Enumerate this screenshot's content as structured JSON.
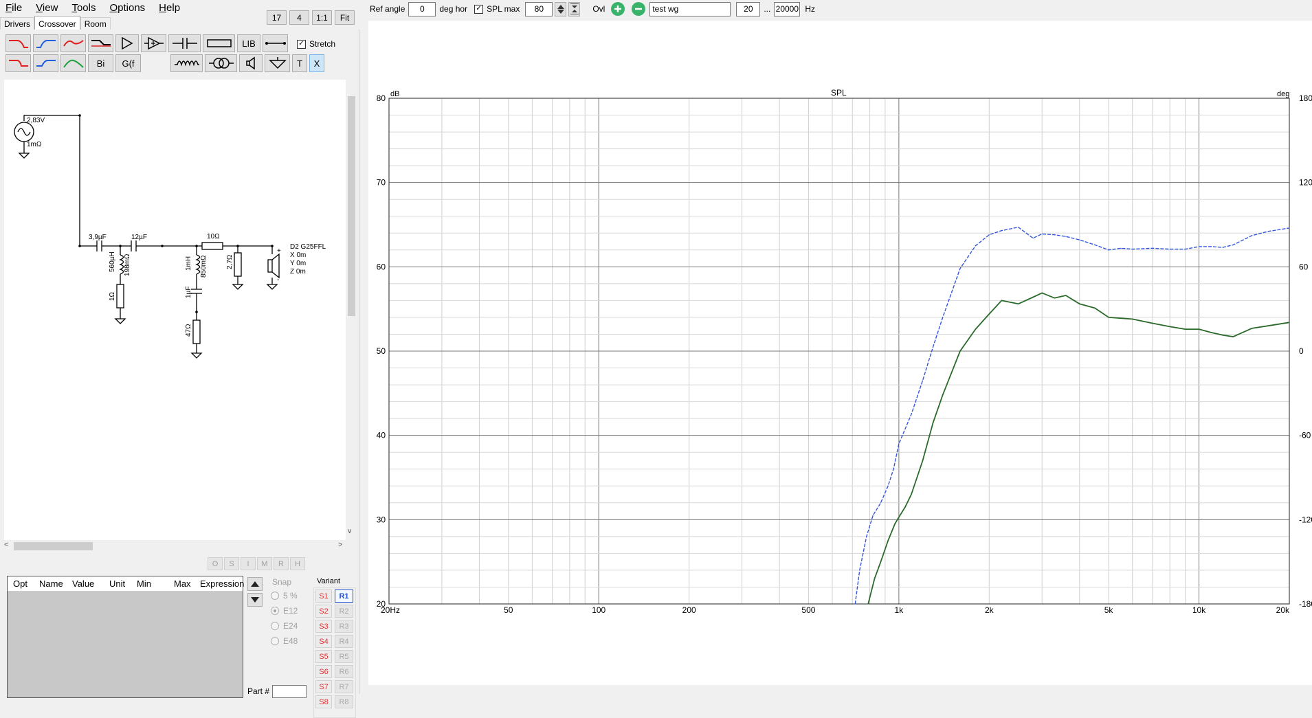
{
  "menu": [
    {
      "pre": "",
      "ul": "F",
      "post": "ile"
    },
    {
      "pre": "",
      "ul": "V",
      "post": "iew"
    },
    {
      "pre": "",
      "ul": "T",
      "post": "ools"
    },
    {
      "pre": "",
      "ul": "O",
      "post": "ptions"
    },
    {
      "pre": "",
      "ul": "H",
      "post": "elp"
    }
  ],
  "top_controls": {
    "grid1": "17",
    "grid2": "4",
    "zoom": "1:1",
    "fit": "Fit"
  },
  "tabs": [
    "Drivers",
    "Crossover",
    "Room"
  ],
  "active_tab": "Crossover",
  "toolbar": {
    "lib": "LIB",
    "bi": "Bi",
    "gf": "G(f",
    "t": "T",
    "x": "X",
    "stretch_label": "Stretch",
    "stretch_checked": true
  },
  "schematic": {
    "source_voltage": "2,83V",
    "source_res": "1mΩ",
    "c1": "3,9µF",
    "c2": "12µF",
    "l1": "560µH",
    "l1_res": "198mΩ",
    "r1": "1Ω",
    "l2": "1mH",
    "l2_res": "850mΩ",
    "c3": "1µF",
    "r2": "47Ω",
    "r_series": "10Ω",
    "r3": "2,7Ω",
    "driver": "D2 G25FFL",
    "driver_x": "X 0m",
    "driver_y": "Y 0m",
    "driver_z": "Z 0m",
    "plus": "+",
    "minus": "-"
  },
  "opt_buttons": [
    "O",
    "S",
    "I",
    "M",
    "R",
    "H"
  ],
  "opt_table": {
    "columns": [
      "Opt",
      "Name",
      "Value",
      "Unit",
      "Min",
      "Max",
      "Expression"
    ]
  },
  "snap": {
    "label": "Snap",
    "options": [
      "5 %",
      "E12",
      "E24",
      "E48"
    ],
    "selected": "E12"
  },
  "variant": {
    "label": "Variant",
    "s": [
      "S1",
      "S2",
      "S3",
      "S4",
      "S5",
      "S6",
      "S7",
      "S8"
    ],
    "r": [
      "R1",
      "R2",
      "R3",
      "R4",
      "R5",
      "R6",
      "R7",
      "R8"
    ],
    "selected": "R1"
  },
  "part": {
    "label": "Part #",
    "value": ""
  },
  "rightbar": {
    "ref_angle_label": "Ref angle",
    "ref_angle": "0",
    "deg_hor": "deg hor",
    "spl_max_label": "SPL max",
    "spl_max_checked": true,
    "spl_max": "80",
    "ovl": "Ovl",
    "name_field": "test wg",
    "f_low": "20",
    "dots": "...",
    "f_high": "20000",
    "hz": "Hz"
  },
  "colors": {
    "blue_series": "#3355dd",
    "green_series": "#2a6a2a",
    "add": "#3ab36a",
    "remove": "#3ab36a",
    "variant_s": "#e03030",
    "variant_sel": "#2050d0"
  },
  "chart_data": {
    "type": "line",
    "title": "SPL",
    "ylabel": "dB",
    "y2label": "deg",
    "xscale": "log",
    "xlim": [
      20,
      20000
    ],
    "ylim": [
      20,
      80
    ],
    "y2lim": [
      -180,
      180
    ],
    "x_ticks": [
      20,
      50,
      100,
      200,
      500,
      1000,
      2000,
      5000,
      10000,
      20000
    ],
    "x_tick_labels": [
      "20Hz",
      "50",
      "100",
      "200",
      "500",
      "1k",
      "2k",
      "5k",
      "10k",
      "20k"
    ],
    "y_ticks": [
      20,
      30,
      40,
      50,
      60,
      70,
      80
    ],
    "y_tick_labels": [
      "20",
      "30",
      "40",
      "50",
      "60",
      "70",
      "80"
    ],
    "y2_ticks": [
      -180,
      -120,
      -60,
      0,
      60,
      120,
      180
    ],
    "y2_tick_labels": [
      "-180",
      "-120",
      "-60",
      "0",
      "60",
      "120",
      "180"
    ],
    "grid": true,
    "series": [
      {
        "style": "dashed",
        "x": [
          715,
          740,
          780,
          820,
          870,
          920,
          960,
          1000,
          1100,
          1200,
          1300,
          1400,
          1500,
          1600,
          1800,
          2000,
          2200,
          2500,
          2800,
          3000,
          3300,
          3600,
          4000,
          4500,
          5000,
          5500,
          6000,
          7000,
          8000,
          9000,
          10000,
          11000,
          12000,
          13000,
          15000,
          17000,
          20000
        ],
        "y": [
          20,
          24,
          28,
          30.5,
          32,
          34,
          36,
          39,
          42.5,
          46.5,
          50.5,
          54,
          57,
          59.8,
          62.5,
          63.8,
          64.3,
          64.7,
          63.4,
          63.9,
          63.8,
          63.6,
          63.2,
          62.6,
          62,
          62.2,
          62.1,
          62.2,
          62.1,
          62.1,
          62.4,
          62.4,
          62.3,
          62.6,
          63.7,
          64.2,
          64.6
        ]
      },
      {
        "style": "solid",
        "x": [
          790,
          830,
          870,
          920,
          970,
          1000,
          1050,
          1100,
          1200,
          1300,
          1400,
          1500,
          1600,
          1800,
          2000,
          2200,
          2500,
          2800,
          3000,
          3300,
          3600,
          4000,
          4500,
          5000,
          5500,
          6000,
          7000,
          8000,
          9000,
          10000,
          11000,
          12000,
          13000,
          15000,
          17000,
          20000
        ],
        "y": [
          20,
          23,
          25,
          27.5,
          29.5,
          30.3,
          31.5,
          33,
          37,
          41.5,
          44.8,
          47.5,
          50,
          52.6,
          54.4,
          56,
          55.6,
          56.4,
          56.9,
          56.3,
          56.6,
          55.6,
          55.1,
          54,
          53.9,
          53.8,
          53.3,
          52.9,
          52.6,
          52.6,
          52.2,
          51.9,
          51.7,
          52.7,
          53,
          53.4
        ]
      }
    ]
  }
}
